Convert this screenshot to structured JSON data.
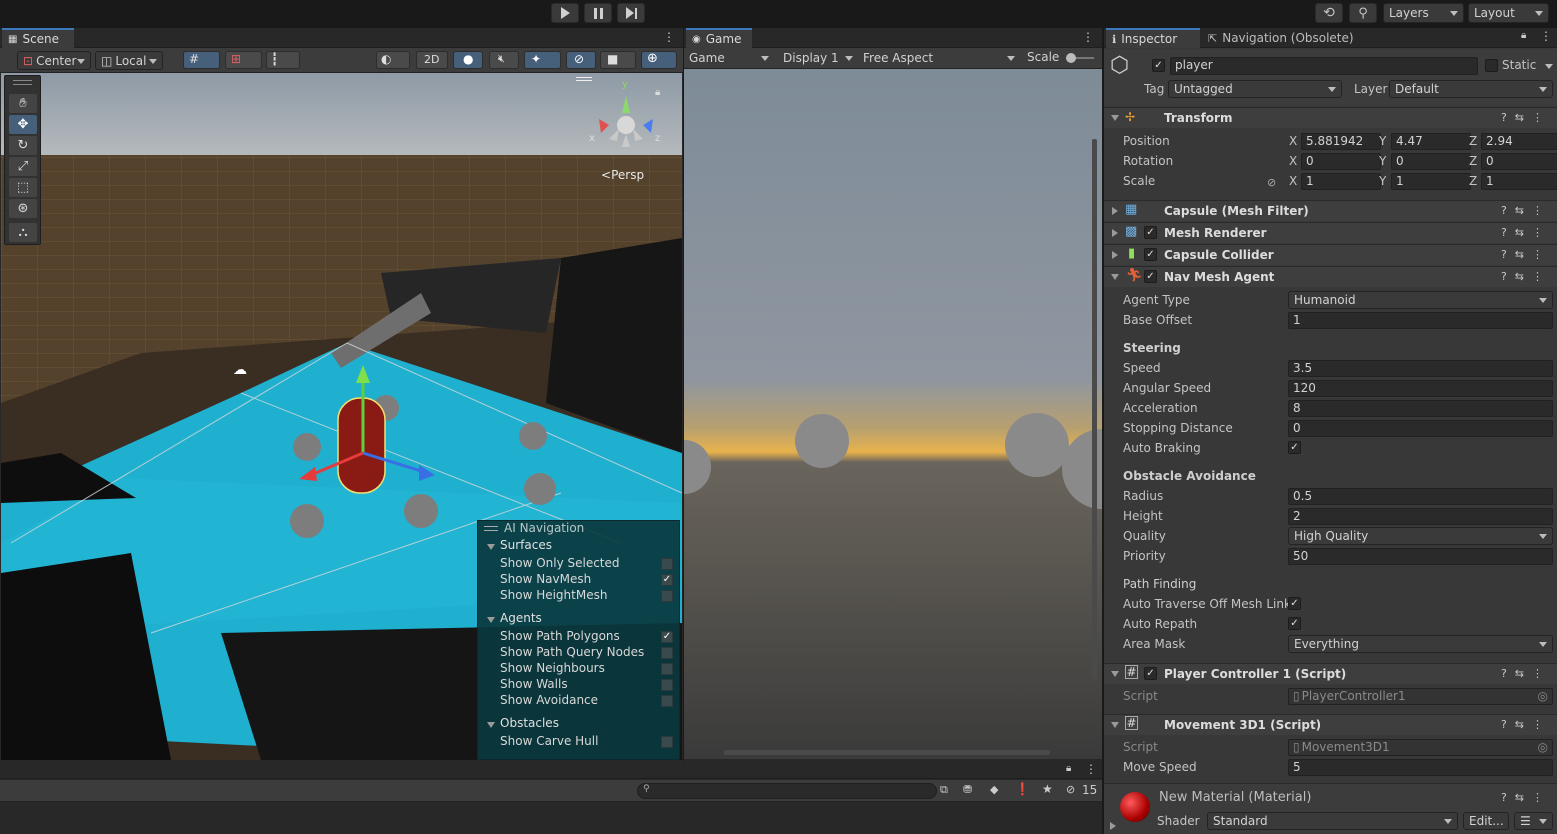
{
  "topbar": {
    "layers": "Layers",
    "layout": "Layout"
  },
  "scene": {
    "tab": "Scene",
    "pivot": "Center",
    "space": "Local",
    "mode2d": "2D",
    "persp": "Persp",
    "gizmo": {
      "y": "y",
      "x": "x",
      "z": "z"
    },
    "ai_nav": {
      "title": "AI Navigation",
      "surfaces": "Surfaces",
      "surface_items": [
        {
          "label": "Show Only Selected",
          "checked": ""
        },
        {
          "label": "Show NavMesh",
          "checked": "✓"
        },
        {
          "label": "Show HeightMesh",
          "checked": ""
        }
      ],
      "agents": "Agents",
      "agent_items": [
        {
          "label": "Show Path Polygons",
          "checked": "✓"
        },
        {
          "label": "Show Path Query Nodes",
          "checked": ""
        },
        {
          "label": "Show Neighbours",
          "checked": ""
        },
        {
          "label": "Show Walls",
          "checked": ""
        },
        {
          "label": "Show Avoidance",
          "checked": ""
        }
      ],
      "obstacles": "Obstacles",
      "obstacle_items": [
        {
          "label": "Show Carve Hull",
          "checked": ""
        }
      ]
    }
  },
  "game": {
    "tab": "Game",
    "view": "Game",
    "display": "Display 1",
    "aspect": "Free Aspect",
    "scale": "Scale"
  },
  "inspector": {
    "tab": "Inspector",
    "tab2": "Navigation (Obsolete)",
    "object_name": "player",
    "static_label": "Static",
    "tag_label": "Tag",
    "tag": "Untagged",
    "layer_label": "Layer",
    "layer": "Default",
    "transform": {
      "title": "Transform",
      "rows": [
        {
          "label": "Position",
          "x": "5.881942",
          "y": "4.47",
          "z": "2.94"
        },
        {
          "label": "Rotation",
          "x": "0",
          "y": "0",
          "z": "0"
        },
        {
          "label": "Scale",
          "x": "1",
          "y": "1",
          "z": "1"
        }
      ],
      "axis_x": "X",
      "axis_y": "Y",
      "axis_z": "Z"
    },
    "mesh_filter": "Capsule (Mesh Filter)",
    "mesh_renderer": "Mesh Renderer",
    "capsule_collider": "Capsule Collider",
    "nav_agent": {
      "title": "Nav Mesh Agent",
      "agent_type_label": "Agent Type",
      "agent_type": "Humanoid",
      "base_offset_label": "Base Offset",
      "base_offset": "1",
      "steering": "Steering",
      "speed_label": "Speed",
      "speed": "3.5",
      "angular_label": "Angular Speed",
      "angular": "120",
      "accel_label": "Acceleration",
      "accel": "8",
      "stop_label": "Stopping Distance",
      "stop": "0",
      "brake_label": "Auto Braking",
      "obstacle": "Obstacle Avoidance",
      "radius_label": "Radius",
      "radius": "0.5",
      "height_label": "Height",
      "height": "2",
      "quality_label": "Quality",
      "quality": "High Quality",
      "priority_label": "Priority",
      "priority": "50",
      "path": "Path Finding",
      "traverse_label": "Auto Traverse Off Mesh Link",
      "repath_label": "Auto Repath",
      "mask_label": "Area Mask",
      "mask": "Everything"
    },
    "player_ctrl": {
      "title": "Player Controller 1 (Script)",
      "script_label": "Script",
      "script": "PlayerController1"
    },
    "movement": {
      "title": "Movement 3D1 (Script)",
      "script_label": "Script",
      "script": "Movement3D1",
      "speed_label": "Move Speed",
      "speed": "5"
    },
    "material": {
      "title": "New Material (Material)",
      "shader_label": "Shader",
      "shader": "Standard",
      "edit": "Edit..."
    }
  },
  "console": {
    "count": "15"
  }
}
